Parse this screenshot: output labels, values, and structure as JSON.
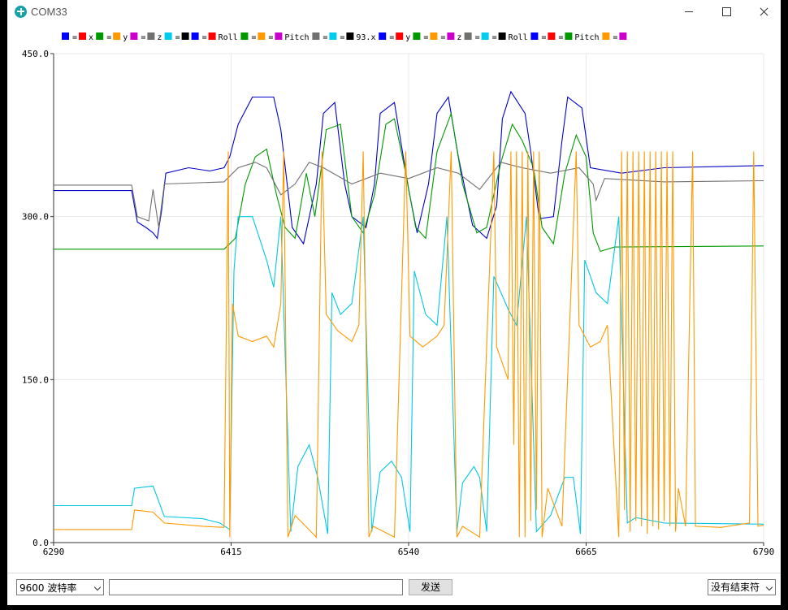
{
  "window": {
    "title": "COM33"
  },
  "controls": {
    "baud_rate": "9600 波特率",
    "send_input_value": "",
    "send_label": "发送",
    "line_ending": "没有结束符"
  },
  "chart_data": {
    "type": "line",
    "title": "",
    "xlabel": "",
    "ylabel": "",
    "xlim": [
      6290,
      6790
    ],
    "ylim": [
      0,
      450
    ],
    "x_ticks": [
      "6290",
      "6415",
      "6540",
      "6665",
      "6790"
    ],
    "y_ticks": [
      "0.0",
      "150.0",
      "300.0",
      "450.0"
    ],
    "grid": true,
    "legend_position": "top",
    "legend": [
      {
        "label": "x",
        "swatches": [
          "#0000ff",
          "#ff0000"
        ]
      },
      {
        "label": "y",
        "swatches": [
          "#009900",
          "#ff9900"
        ]
      },
      {
        "label": "z",
        "swatches": [
          "#cc00cc",
          "#707070"
        ]
      },
      {
        "label": "",
        "swatches": [
          "#00ccee",
          "#000000"
        ]
      },
      {
        "label": "Roll",
        "swatches": [
          "#0000ff",
          "#ff0000"
        ]
      },
      {
        "label": "Pitch",
        "swatches": [
          "#009900",
          "#ff9900",
          "#cc00cc"
        ]
      },
      {
        "label": "93.x",
        "swatches": [
          "#707070",
          "#00ccee",
          "#000000"
        ]
      },
      {
        "label": "y",
        "swatches": [
          "#0000ff",
          "#ff0000"
        ]
      },
      {
        "label": "z",
        "swatches": [
          "#009900",
          "#ff9900",
          "#cc00cc"
        ]
      },
      {
        "label": "Roll",
        "swatches": [
          "#707070",
          "#00ccee",
          "#000000"
        ]
      },
      {
        "label": "Pitch",
        "swatches": [
          "#0000ff",
          "#ff0000",
          "#009900"
        ]
      },
      {
        "label": "",
        "swatches": [
          "#ff9900",
          "#cc00cc"
        ]
      }
    ],
    "series": [
      {
        "color": "#0000cc",
        "points": [
          [
            6290,
            324
          ],
          [
            6345,
            324
          ],
          [
            6349,
            295
          ],
          [
            6355,
            290
          ],
          [
            6360,
            285
          ],
          [
            6363,
            280
          ],
          [
            6366,
            305
          ],
          [
            6369,
            340
          ],
          [
            6385,
            345
          ],
          [
            6400,
            342
          ],
          [
            6410,
            345
          ],
          [
            6414,
            355
          ],
          [
            6420,
            385
          ],
          [
            6430,
            410
          ],
          [
            6445,
            410
          ],
          [
            6450,
            380
          ],
          [
            6458,
            290
          ],
          [
            6466,
            275
          ],
          [
            6475,
            330
          ],
          [
            6480,
            395
          ],
          [
            6488,
            405
          ],
          [
            6495,
            330
          ],
          [
            6500,
            300
          ],
          [
            6510,
            290
          ],
          [
            6516,
            330
          ],
          [
            6520,
            395
          ],
          [
            6530,
            405
          ],
          [
            6540,
            325
          ],
          [
            6546,
            285
          ],
          [
            6554,
            330
          ],
          [
            6560,
            395
          ],
          [
            6568,
            410
          ],
          [
            6575,
            355
          ],
          [
            6585,
            292
          ],
          [
            6595,
            280
          ],
          [
            6602,
            310
          ],
          [
            6606,
            390
          ],
          [
            6612,
            415
          ],
          [
            6622,
            395
          ],
          [
            6626,
            360
          ],
          [
            6632,
            298
          ],
          [
            6642,
            300
          ],
          [
            6648,
            370
          ],
          [
            6652,
            410
          ],
          [
            6662,
            400
          ],
          [
            6668,
            345
          ],
          [
            6690,
            340
          ],
          [
            6720,
            345
          ],
          [
            6790,
            347
          ]
        ]
      },
      {
        "color": "#009900",
        "points": [
          [
            6290,
            270
          ],
          [
            6410,
            270
          ],
          [
            6418,
            280
          ],
          [
            6425,
            330
          ],
          [
            6432,
            355
          ],
          [
            6440,
            362
          ],
          [
            6447,
            320
          ],
          [
            6453,
            290
          ],
          [
            6460,
            280
          ],
          [
            6468,
            340
          ],
          [
            6474,
            300
          ],
          [
            6482,
            380
          ],
          [
            6492,
            385
          ],
          [
            6500,
            300
          ],
          [
            6508,
            285
          ],
          [
            6516,
            320
          ],
          [
            6524,
            385
          ],
          [
            6530,
            390
          ],
          [
            6538,
            340
          ],
          [
            6545,
            290
          ],
          [
            6552,
            280
          ],
          [
            6560,
            360
          ],
          [
            6570,
            395
          ],
          [
            6578,
            330
          ],
          [
            6588,
            285
          ],
          [
            6595,
            290
          ],
          [
            6605,
            350
          ],
          [
            6613,
            385
          ],
          [
            6620,
            370
          ],
          [
            6628,
            345
          ],
          [
            6634,
            290
          ],
          [
            6642,
            275
          ],
          [
            6650,
            340
          ],
          [
            6658,
            375
          ],
          [
            6665,
            355
          ],
          [
            6670,
            285
          ],
          [
            6675,
            268
          ],
          [
            6685,
            272
          ],
          [
            6790,
            273
          ]
        ]
      },
      {
        "color": "#707070",
        "points": [
          [
            6290,
            329
          ],
          [
            6345,
            329
          ],
          [
            6349,
            300
          ],
          [
            6357,
            296
          ],
          [
            6360,
            325
          ],
          [
            6364,
            290
          ],
          [
            6368,
            330
          ],
          [
            6410,
            332
          ],
          [
            6420,
            345
          ],
          [
            6432,
            350
          ],
          [
            6440,
            345
          ],
          [
            6450,
            320
          ],
          [
            6460,
            330
          ],
          [
            6470,
            350
          ],
          [
            6480,
            345
          ],
          [
            6500,
            330
          ],
          [
            6520,
            340
          ],
          [
            6540,
            335
          ],
          [
            6560,
            345
          ],
          [
            6575,
            340
          ],
          [
            6590,
            325
          ],
          [
            6605,
            350
          ],
          [
            6620,
            345
          ],
          [
            6640,
            340
          ],
          [
            6660,
            345
          ],
          [
            6670,
            330
          ],
          [
            6672,
            315
          ],
          [
            6678,
            335
          ],
          [
            6720,
            332
          ],
          [
            6790,
            333
          ]
        ]
      },
      {
        "color": "#00c8e6",
        "points": [
          [
            6290,
            34
          ],
          [
            6345,
            34
          ],
          [
            6347,
            50
          ],
          [
            6360,
            52
          ],
          [
            6368,
            24
          ],
          [
            6395,
            22
          ],
          [
            6407,
            18
          ],
          [
            6414,
            12
          ],
          [
            6417,
            250
          ],
          [
            6420,
            300
          ],
          [
            6430,
            300
          ],
          [
            6440,
            260
          ],
          [
            6445,
            235
          ],
          [
            6450,
            300
          ],
          [
            6457,
            10
          ],
          [
            6462,
            70
          ],
          [
            6470,
            90
          ],
          [
            6476,
            60
          ],
          [
            6483,
            8
          ],
          [
            6486,
            230
          ],
          [
            6492,
            210
          ],
          [
            6500,
            220
          ],
          [
            6508,
            300
          ],
          [
            6514,
            10
          ],
          [
            6520,
            65
          ],
          [
            6528,
            75
          ],
          [
            6535,
            60
          ],
          [
            6541,
            10
          ],
          [
            6544,
            250
          ],
          [
            6552,
            210
          ],
          [
            6560,
            200
          ],
          [
            6567,
            300
          ],
          [
            6574,
            10
          ],
          [
            6578,
            55
          ],
          [
            6586,
            70
          ],
          [
            6590,
            60
          ],
          [
            6595,
            10
          ],
          [
            6600,
            245
          ],
          [
            6610,
            215
          ],
          [
            6616,
            200
          ],
          [
            6623,
            300
          ],
          [
            6630,
            10
          ],
          [
            6640,
            25
          ],
          [
            6650,
            60
          ],
          [
            6656,
            60
          ],
          [
            6661,
            8
          ],
          [
            6664,
            260
          ],
          [
            6672,
            230
          ],
          [
            6680,
            220
          ],
          [
            6688,
            300
          ],
          [
            6694,
            18
          ],
          [
            6700,
            23
          ],
          [
            6720,
            18
          ],
          [
            6790,
            17
          ]
        ]
      },
      {
        "color": "#ff9900",
        "points": [
          [
            6290,
            12
          ],
          [
            6345,
            12
          ],
          [
            6347,
            30
          ],
          [
            6360,
            28
          ],
          [
            6368,
            18
          ],
          [
            6395,
            15
          ],
          [
            6410,
            14
          ],
          [
            6413,
            360
          ],
          [
            6414,
            5
          ],
          [
            6416,
            220
          ],
          [
            6420,
            190
          ],
          [
            6430,
            185
          ],
          [
            6440,
            190
          ],
          [
            6445,
            180
          ],
          [
            6450,
            220
          ],
          [
            6452,
            360
          ],
          [
            6455,
            5
          ],
          [
            6460,
            25
          ],
          [
            6475,
            5
          ],
          [
            6479,
            360
          ],
          [
            6482,
            210
          ],
          [
            6490,
            195
          ],
          [
            6500,
            185
          ],
          [
            6505,
            200
          ],
          [
            6508,
            360
          ],
          [
            6512,
            5
          ],
          [
            6515,
            15
          ],
          [
            6530,
            5
          ],
          [
            6538,
            360
          ],
          [
            6541,
            190
          ],
          [
            6550,
            180
          ],
          [
            6560,
            190
          ],
          [
            6565,
            200
          ],
          [
            6570,
            360
          ],
          [
            6574,
            5
          ],
          [
            6578,
            15
          ],
          [
            6590,
            5
          ],
          [
            6600,
            360
          ],
          [
            6602,
            180
          ],
          [
            6610,
            150
          ],
          [
            6612,
            360
          ],
          [
            6614,
            90
          ],
          [
            6616,
            360
          ],
          [
            6618,
            5
          ],
          [
            6620,
            360
          ],
          [
            6622,
            5
          ],
          [
            6624,
            360
          ],
          [
            6626,
            20
          ],
          [
            6628,
            360
          ],
          [
            6630,
            30
          ],
          [
            6632,
            360
          ],
          [
            6634,
            5
          ],
          [
            6638,
            50
          ],
          [
            6648,
            15
          ],
          [
            6658,
            360
          ],
          [
            6660,
            200
          ],
          [
            6668,
            180
          ],
          [
            6675,
            185
          ],
          [
            6680,
            200
          ],
          [
            6688,
            5
          ],
          [
            6690,
            360
          ],
          [
            6692,
            30
          ],
          [
            6694,
            360
          ],
          [
            6696,
            10
          ],
          [
            6698,
            360
          ],
          [
            6700,
            20
          ],
          [
            6702,
            360
          ],
          [
            6704,
            15
          ],
          [
            6706,
            360
          ],
          [
            6708,
            8
          ],
          [
            6710,
            360
          ],
          [
            6712,
            15
          ],
          [
            6714,
            360
          ],
          [
            6716,
            12
          ],
          [
            6718,
            360
          ],
          [
            6720,
            20
          ],
          [
            6722,
            360
          ],
          [
            6724,
            15
          ],
          [
            6726,
            360
          ],
          [
            6728,
            10
          ],
          [
            6730,
            50
          ],
          [
            6735,
            15
          ],
          [
            6740,
            360
          ],
          [
            6742,
            15
          ],
          [
            6760,
            14
          ],
          [
            6780,
            18
          ],
          [
            6783,
            360
          ],
          [
            6786,
            15
          ],
          [
            6790,
            16
          ]
        ]
      }
    ]
  }
}
